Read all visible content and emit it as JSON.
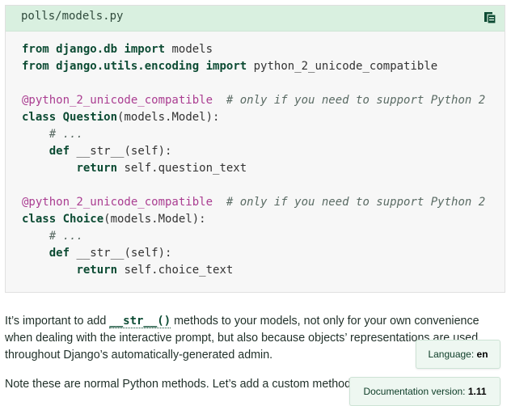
{
  "code_block": {
    "filename": "polls/models.py",
    "lines": {
      "l1_a": "from",
      "l1_b": "django.db",
      "l1_c": "import",
      "l1_d": " models",
      "l2_a": "from",
      "l2_b": "django.utils.encoding",
      "l2_c": "import",
      "l2_d": " python_2_unicode_compatible",
      "dec": "@python_2_unicode_compatible",
      "comment": "# only if you need to support Python 2",
      "class_kw": "class",
      "q_name": "Question",
      "q_base": "(models.Model):",
      "ellipsis": "# ...",
      "def_kw": "def",
      "str_fn": "__str__",
      "self_sig": "(self):",
      "return_kw": "return",
      "q_ret": " self.question_text",
      "c_name": "Choice",
      "c_base": "(models.Model):",
      "c_ret": " self.choice_text"
    }
  },
  "paragraph1": {
    "before": "It’s important to add ",
    "code": "__str__()",
    "after": " methods to your models, not only for your own convenience when dealing with the interactive prompt, but also because objects’ representations are used throughout Django’s automatically-generated admin."
  },
  "paragraph2": {
    "text": "Note these are normal Python methods. Let’s add a custom method, just for demonstration:"
  },
  "language_pill": {
    "label": "Language:",
    "value": "en"
  },
  "version_pill": {
    "label": "Documentation version:",
    "value": "1.11"
  }
}
